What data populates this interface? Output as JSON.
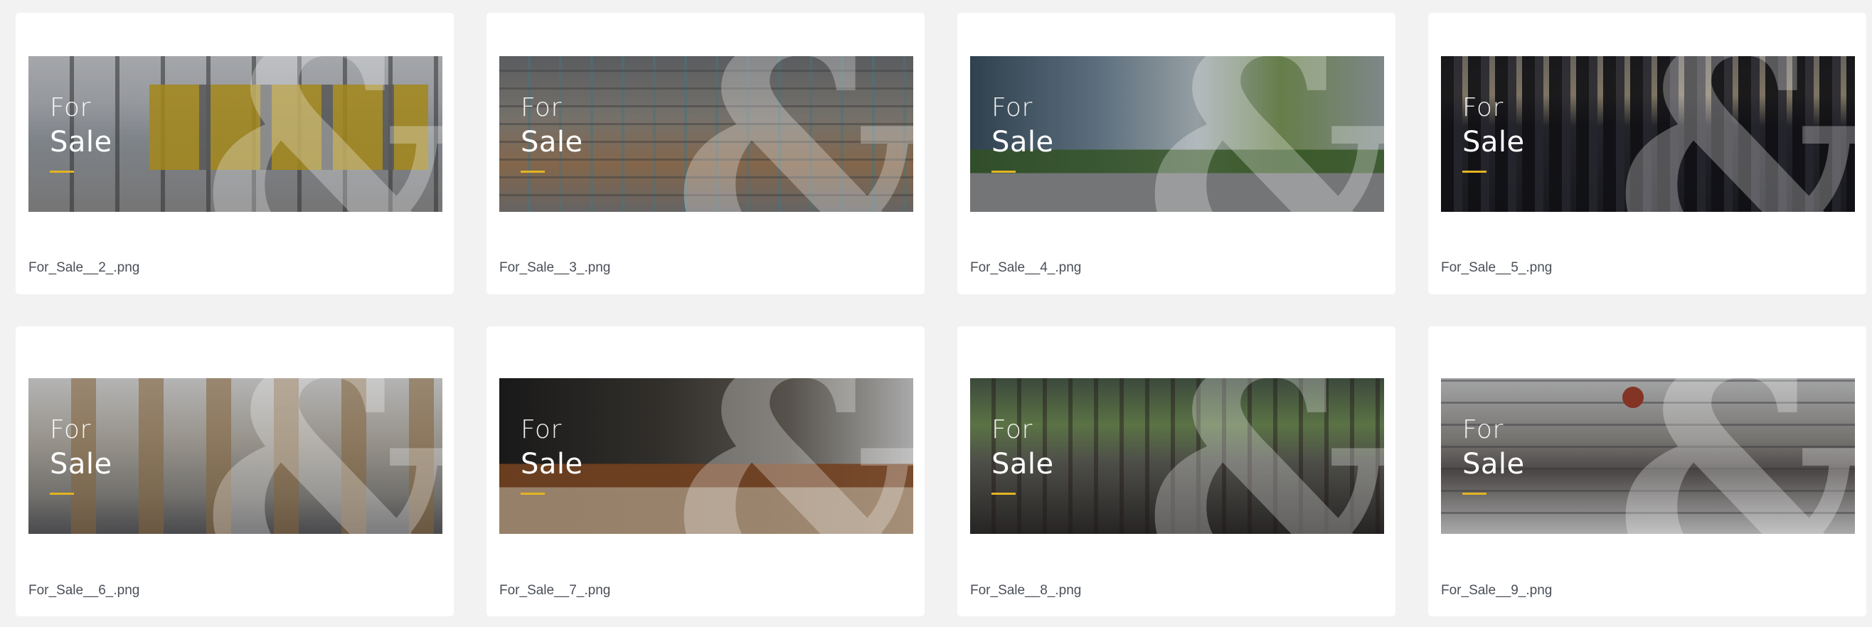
{
  "accent_color": "#e3b422",
  "cards": [
    {
      "for": "For",
      "sale": "Sale",
      "filename": "For_Sale__2_.png",
      "scene": "warehouse-doors"
    },
    {
      "for": "For",
      "sale": "Sale",
      "filename": "For_Sale__3_.png",
      "scene": "warehouse-shelves"
    },
    {
      "for": "For",
      "sale": "Sale",
      "filename": "For_Sale__4_.png",
      "scene": "street"
    },
    {
      "for": "For",
      "sale": "Sale",
      "filename": "For_Sale__5_.png",
      "scene": "skyline"
    },
    {
      "for": "For",
      "sale": "Sale",
      "filename": "For_Sale__6_.png",
      "scene": "shop"
    },
    {
      "for": "For",
      "sale": "Sale",
      "filename": "For_Sale__7_.png",
      "scene": "cafe"
    },
    {
      "for": "For",
      "sale": "Sale",
      "filename": "For_Sale__8_.png",
      "scene": "market"
    },
    {
      "for": "For",
      "sale": "Sale",
      "filename": "For_Sale__9_.png",
      "scene": "mall"
    }
  ]
}
